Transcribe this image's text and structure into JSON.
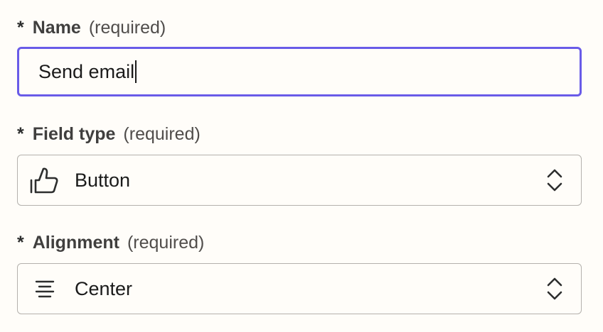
{
  "name_field": {
    "asterisk": "*",
    "label": "Name",
    "hint": "(required)",
    "value": "Send email"
  },
  "field_type": {
    "asterisk": "*",
    "label": "Field type",
    "hint": "(required)",
    "value": "Button",
    "icon": "thumbs-up-icon"
  },
  "alignment": {
    "asterisk": "*",
    "label": "Alignment",
    "hint": "(required)",
    "value": "Center",
    "icon": "align-center-icon"
  },
  "colors": {
    "focus_border": "#695be8",
    "border": "#b4b1ad",
    "background": "#fffdf9"
  }
}
